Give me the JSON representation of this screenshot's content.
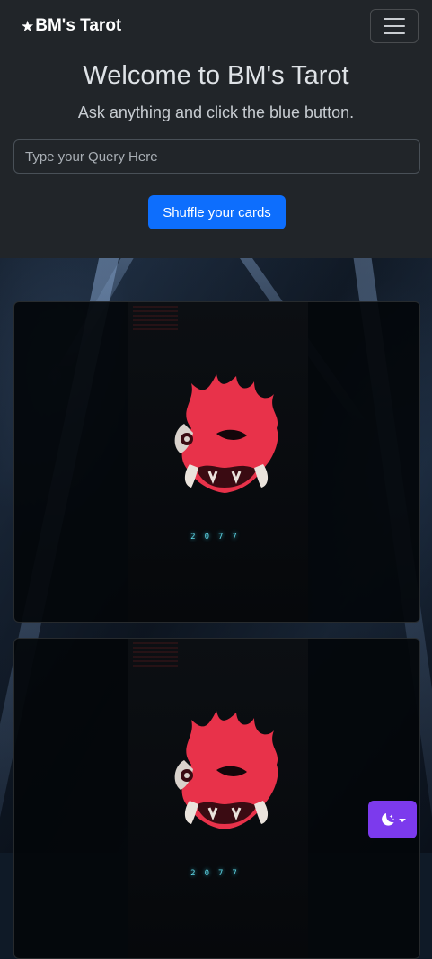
{
  "navbar": {
    "brand_star": "★",
    "brand_text": "BM's Tarot",
    "toggler_icon": "hamburger-icon"
  },
  "header": {
    "title": "Welcome to BM's Tarot",
    "subtitle": "Ask anything and click the blue button."
  },
  "query": {
    "value": "",
    "placeholder": "Type your Query Here"
  },
  "shuffle_button": {
    "label": "Shuffle your cards"
  },
  "cards": [
    {
      "image": "samurai-oni-mask-card",
      "caption": "2077"
    },
    {
      "image": "samurai-oni-mask-card",
      "caption": "2077"
    }
  ],
  "theme_toggle": {
    "icon": "moon-stars-icon"
  },
  "colors": {
    "navbar_bg": "#212529",
    "primary": "#0d6efd",
    "theme_toggle": "#7c3aed",
    "card_mask": "#e8324a",
    "caption": "#5fd6e6"
  }
}
